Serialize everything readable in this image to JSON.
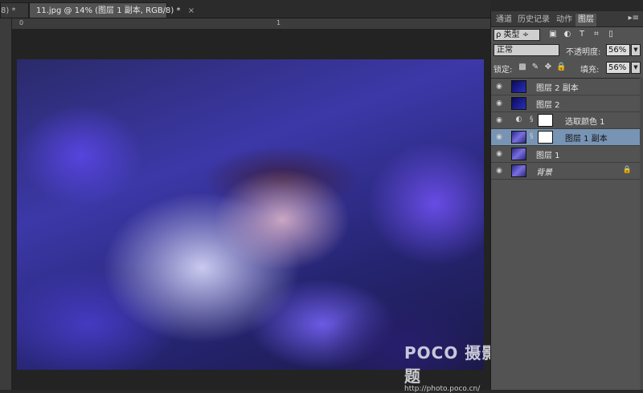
{
  "doc_tabs": {
    "prev_label": "8) *",
    "prev_close": "×",
    "active_label": "11.jpg @ 14% (图层 1 副本, RGB/8) *",
    "active_close": "×"
  },
  "ruler": {
    "label_0": "0",
    "label_1": "1"
  },
  "watermark": {
    "brand": "POCO 摄影专题",
    "url": "http://photo.poco.cn/"
  },
  "panel": {
    "tabs": [
      "通道",
      "历史记录",
      "动作",
      "图层"
    ],
    "menu_glyph": "▸≡",
    "filter_kind": "ρ 类型 ÷",
    "filter_icons": [
      "▣",
      "◐",
      "T",
      "⌗",
      "▯"
    ],
    "blend_mode": "正常",
    "opacity_label": "不透明度:",
    "opacity_value": "56%",
    "lock_label": "锁定:",
    "lock_icons": [
      "▩",
      "✎",
      "✥",
      "🔒"
    ],
    "fill_label": "填充:",
    "fill_value": "56%",
    "layers": [
      {
        "name": "图层 2 副本",
        "thumb": "blue",
        "selected": false
      },
      {
        "name": "图层 2",
        "thumb": "blue",
        "selected": false
      },
      {
        "name": "选取颜色 1",
        "thumb": "adj",
        "selected": false
      },
      {
        "name": "图层 1 副本",
        "thumb": "photo",
        "selected": true
      },
      {
        "name": "图层 1",
        "thumb": "photo",
        "selected": false
      },
      {
        "name": "背景",
        "thumb": "photo",
        "selected": false
      }
    ],
    "eye_glyph": "◉",
    "adj_glyph": "◐",
    "chain_glyph": "§",
    "lock_glyph": "🔒"
  },
  "colors": {
    "selected_layer": "#7894b4",
    "panel_bg": "#535353",
    "app_bg": "#282828"
  }
}
